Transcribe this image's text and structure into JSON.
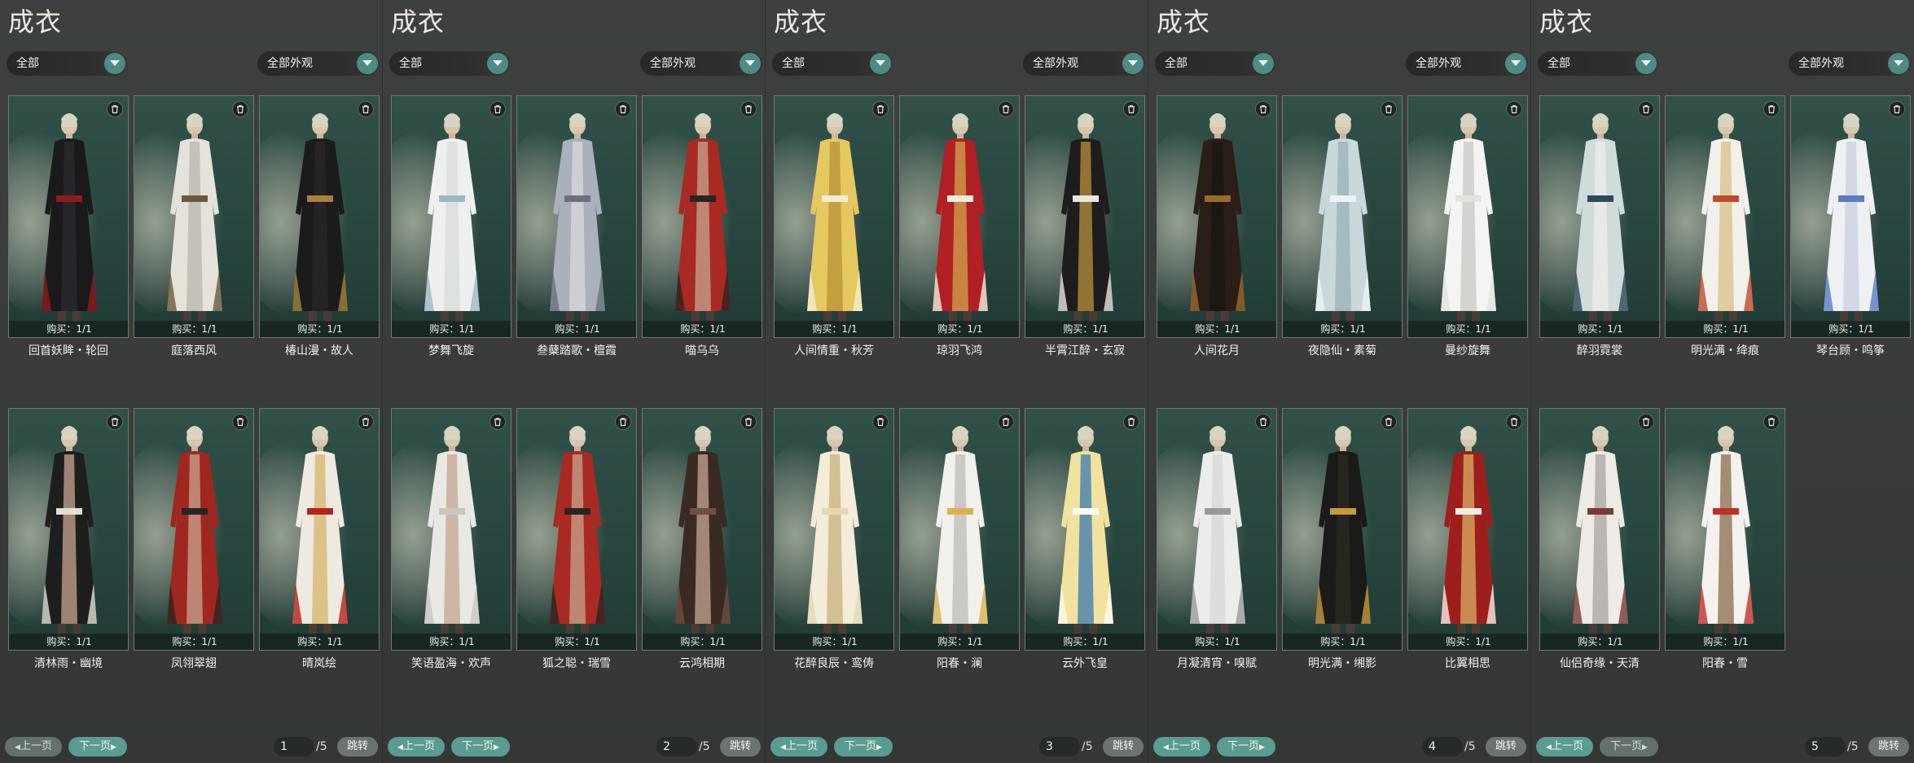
{
  "panels": [
    {
      "title": "成衣",
      "filter_left": "全部",
      "filter_right": "全部外观",
      "page": "1",
      "total": "/5",
      "prev_label": "上一页",
      "next_label": "下一页",
      "prev_enabled": false,
      "next_enabled": true,
      "jump_label": "跳转",
      "items": [
        {
          "buy": "购买：1/1",
          "name": "回首妖眸・轮回",
          "palette": [
            "#1a1a1c",
            "#8e1c1c",
            "#2c2c30"
          ]
        },
        {
          "buy": "购买：1/1",
          "name": "庭落西风",
          "palette": [
            "#e4e2da",
            "#6b5a3a",
            "#b8b6ae"
          ]
        },
        {
          "buy": "购买：1/1",
          "name": "椿山漫・故人",
          "palette": [
            "#1c1b1c",
            "#a8823c",
            "#2a2826"
          ]
        },
        {
          "buy": "购买：1/1",
          "name": "清林雨・幽境",
          "palette": [
            "#1e1e1e",
            "#e2dfd6",
            "#c7a58f"
          ]
        },
        {
          "buy": "购买：1/1",
          "name": "凤翎翠翅",
          "palette": [
            "#a0271f",
            "#2a2422",
            "#c7a58f"
          ]
        },
        {
          "buy": "购买：1/1",
          "name": "晴岚绘",
          "palette": [
            "#eeeae2",
            "#b8201c",
            "#d6b46a"
          ]
        }
      ]
    },
    {
      "title": "成衣",
      "filter_left": "全部",
      "filter_right": "全部外观",
      "page": "2",
      "total": "/5",
      "prev_label": "上一页",
      "next_label": "下一页",
      "prev_enabled": true,
      "next_enabled": true,
      "jump_label": "跳转",
      "items": [
        {
          "buy": "购买：1/1",
          "name": "梦舞飞旋",
          "palette": [
            "#eef0f0",
            "#9fb7c4",
            "#d8dcdc"
          ]
        },
        {
          "buy": "购买：1/1",
          "name": "叁蘖踏歌・檀霞",
          "palette": [
            "#aab0bc",
            "#6c7080",
            "#d8dae0"
          ]
        },
        {
          "buy": "购买：1/1",
          "name": "喵乌乌",
          "palette": [
            "#a82a22",
            "#2a2422",
            "#c7a58f"
          ]
        },
        {
          "buy": "购买：1/1",
          "name": "笑语盈海・欢声",
          "palette": [
            "#e8e8e4",
            "#c9c7c0",
            "#c7a58f"
          ]
        },
        {
          "buy": "购买：1/1",
          "name": "狐之聪・瑞雪",
          "palette": [
            "#a82a22",
            "#2a2422",
            "#c7a58f"
          ]
        },
        {
          "buy": "购买：1/1",
          "name": "云鸿相期",
          "palette": [
            "#3a2a24",
            "#6e5040",
            "#c7a58f"
          ]
        }
      ]
    },
    {
      "title": "成衣",
      "filter_left": "全部",
      "filter_right": "全部外观",
      "page": "3",
      "total": "/5",
      "prev_label": "上一页",
      "next_label": "下一页",
      "prev_enabled": true,
      "next_enabled": true,
      "jump_label": "跳转",
      "items": [
        {
          "buy": "购买：1/1",
          "name": "人间情重・秋芳",
          "palette": [
            "#e6c860",
            "#f4ecd0",
            "#b89238"
          ]
        },
        {
          "buy": "购买：1/1",
          "name": "琼羽飞鸿",
          "palette": [
            "#b02024",
            "#f0ece4",
            "#d2a44c"
          ]
        },
        {
          "buy": "购买：1/1",
          "name": "半霄江醉・玄寂",
          "palette": [
            "#1e1c1c",
            "#e8e6e0",
            "#b8903c"
          ]
        },
        {
          "buy": "购买：1/1",
          "name": "花醉良辰・鸾俦",
          "palette": [
            "#f2ecd8",
            "#e4d8b4",
            "#c8b07a"
          ]
        },
        {
          "buy": "购买：1/1",
          "name": "阳春・澜",
          "palette": [
            "#f2f0ea",
            "#d8b250",
            "#bfbcb4"
          ]
        },
        {
          "buy": "购买：1/1",
          "name": "云外飞皇",
          "palette": [
            "#f2e2a0",
            "#fafaf0",
            "#3a78b0"
          ]
        }
      ]
    },
    {
      "title": "成衣",
      "filter_left": "全部",
      "filter_right": "全部外观",
      "page": "4",
      "total": "/5",
      "prev_label": "上一页",
      "next_label": "下一页",
      "prev_enabled": true,
      "next_enabled": true,
      "jump_label": "跳转",
      "items": [
        {
          "buy": "购买：1/1",
          "name": "人间花月",
          "palette": [
            "#2a1e16",
            "#9a6a2c",
            "#1a1614"
          ]
        },
        {
          "buy": "购买：1/1",
          "name": "夜隐仙・素菊",
          "palette": [
            "#c8d8dc",
            "#eef2f2",
            "#9cb0b8"
          ]
        },
        {
          "buy": "购买：1/1",
          "name": "曼纱旋舞",
          "palette": [
            "#f4f4f2",
            "#e2e2de",
            "#c8c8c4"
          ]
        },
        {
          "buy": "购买：1/1",
          "name": "月凝清宵・嗅赋",
          "palette": [
            "#ececea",
            "#9a9a9c",
            "#d8d8d4"
          ]
        },
        {
          "buy": "购买：1/1",
          "name": "明光满・缃影",
          "palette": [
            "#1c1a18",
            "#c89a3c",
            "#2e2a24"
          ]
        },
        {
          "buy": "购买：1/1",
          "name": "比翼相思",
          "palette": [
            "#9e1e1c",
            "#f0ece6",
            "#d8b066"
          ]
        }
      ]
    },
    {
      "title": "成衣",
      "filter_left": "全部",
      "filter_right": "全部外观",
      "page": "5",
      "total": "/5",
      "prev_label": "上一页",
      "next_label": "下一页",
      "prev_enabled": true,
      "next_enabled": false,
      "jump_label": "跳转",
      "items": [
        {
          "buy": "购买：1/1",
          "name": "醉羽霓裳",
          "palette": [
            "#d0dcdc",
            "#2c4a58",
            "#eeeeea"
          ]
        },
        {
          "buy": "购买：1/1",
          "name": "明光满・绛痕",
          "palette": [
            "#f2f0ea",
            "#c04a2c",
            "#d8c08a"
          ]
        },
        {
          "buy": "购买：1/1",
          "name": "琴台顾・鸣筝",
          "palette": [
            "#eef0f4",
            "#5a7cc0",
            "#c8d0e0"
          ]
        },
        {
          "buy": "购买：1/1",
          "name": "仙侣奇缘・天清",
          "palette": [
            "#eeeae4",
            "#7a3a34",
            "#a8a4a0"
          ]
        },
        {
          "buy": "购买：1/1",
          "name": "阳春・雪",
          "palette": [
            "#f4f2ee",
            "#c0302a",
            "#8a6a4c"
          ]
        }
      ]
    }
  ],
  "icons": {
    "dropdown": "chevron-down-icon",
    "delete": "trash-icon"
  },
  "colors": {
    "accent": "#5a9c91",
    "card_bg": "#2a4842",
    "button_disabled": "#63706b"
  }
}
